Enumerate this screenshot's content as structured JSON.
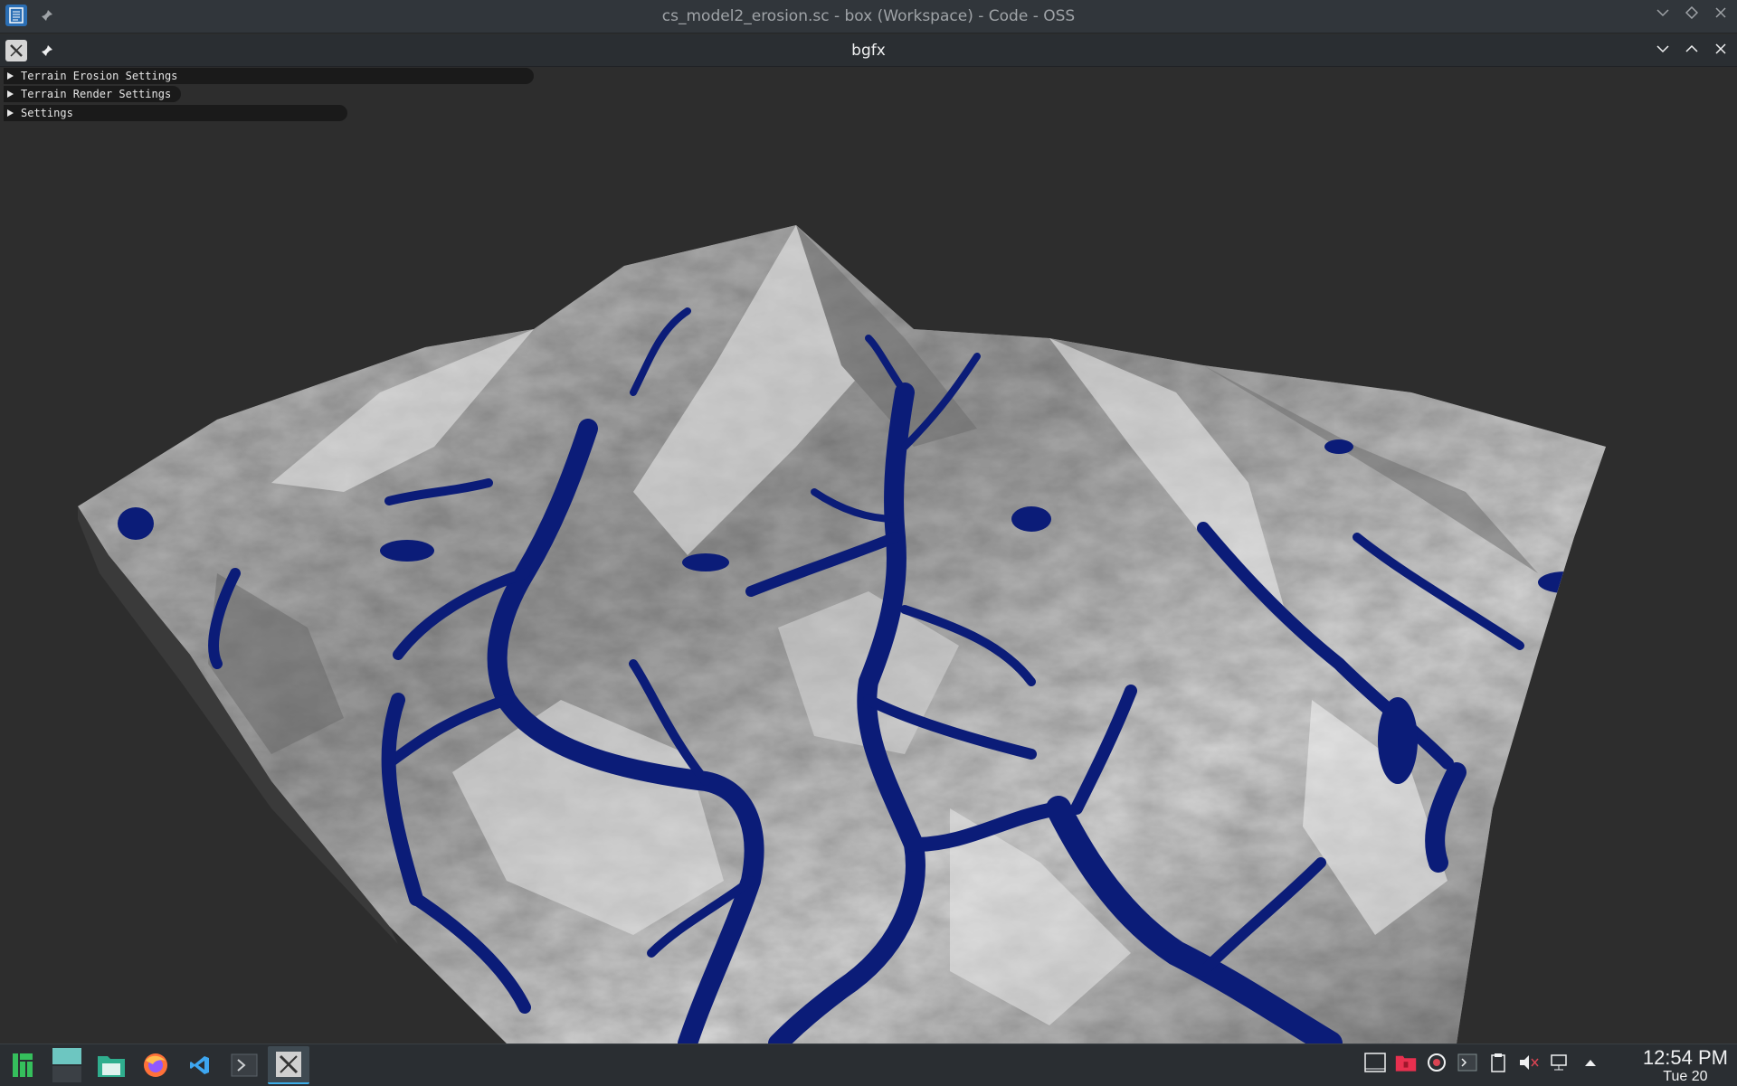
{
  "outer_window": {
    "title": "cs_model2_erosion.sc - box (Workspace) - Code - OSS"
  },
  "inner_window": {
    "title": "bgfx"
  },
  "imgui": {
    "panels": [
      {
        "label": "Terrain Erosion Settings"
      },
      {
        "label": "Terrain Render Settings"
      },
      {
        "label": "Settings"
      }
    ]
  },
  "taskbar": {
    "apps": [
      "application-menu",
      "desktop-pager",
      "file-manager",
      "firefox",
      "vscode",
      "terminal",
      "x-window"
    ],
    "tray_icons": [
      "show-desktop",
      "trash-notification",
      "updates",
      "terminal-tray",
      "clipboard",
      "volume-muted",
      "network",
      "expand-tray"
    ],
    "clock": {
      "time": "12:54 PM",
      "date": "Tue 20"
    }
  },
  "colors": {
    "titlebar": "#31363b",
    "viewport_bg": "#2d2d2d",
    "terrain_light": "#d8d8d8",
    "terrain_dark": "#5a5a5a",
    "water": "#0a1e7a"
  }
}
